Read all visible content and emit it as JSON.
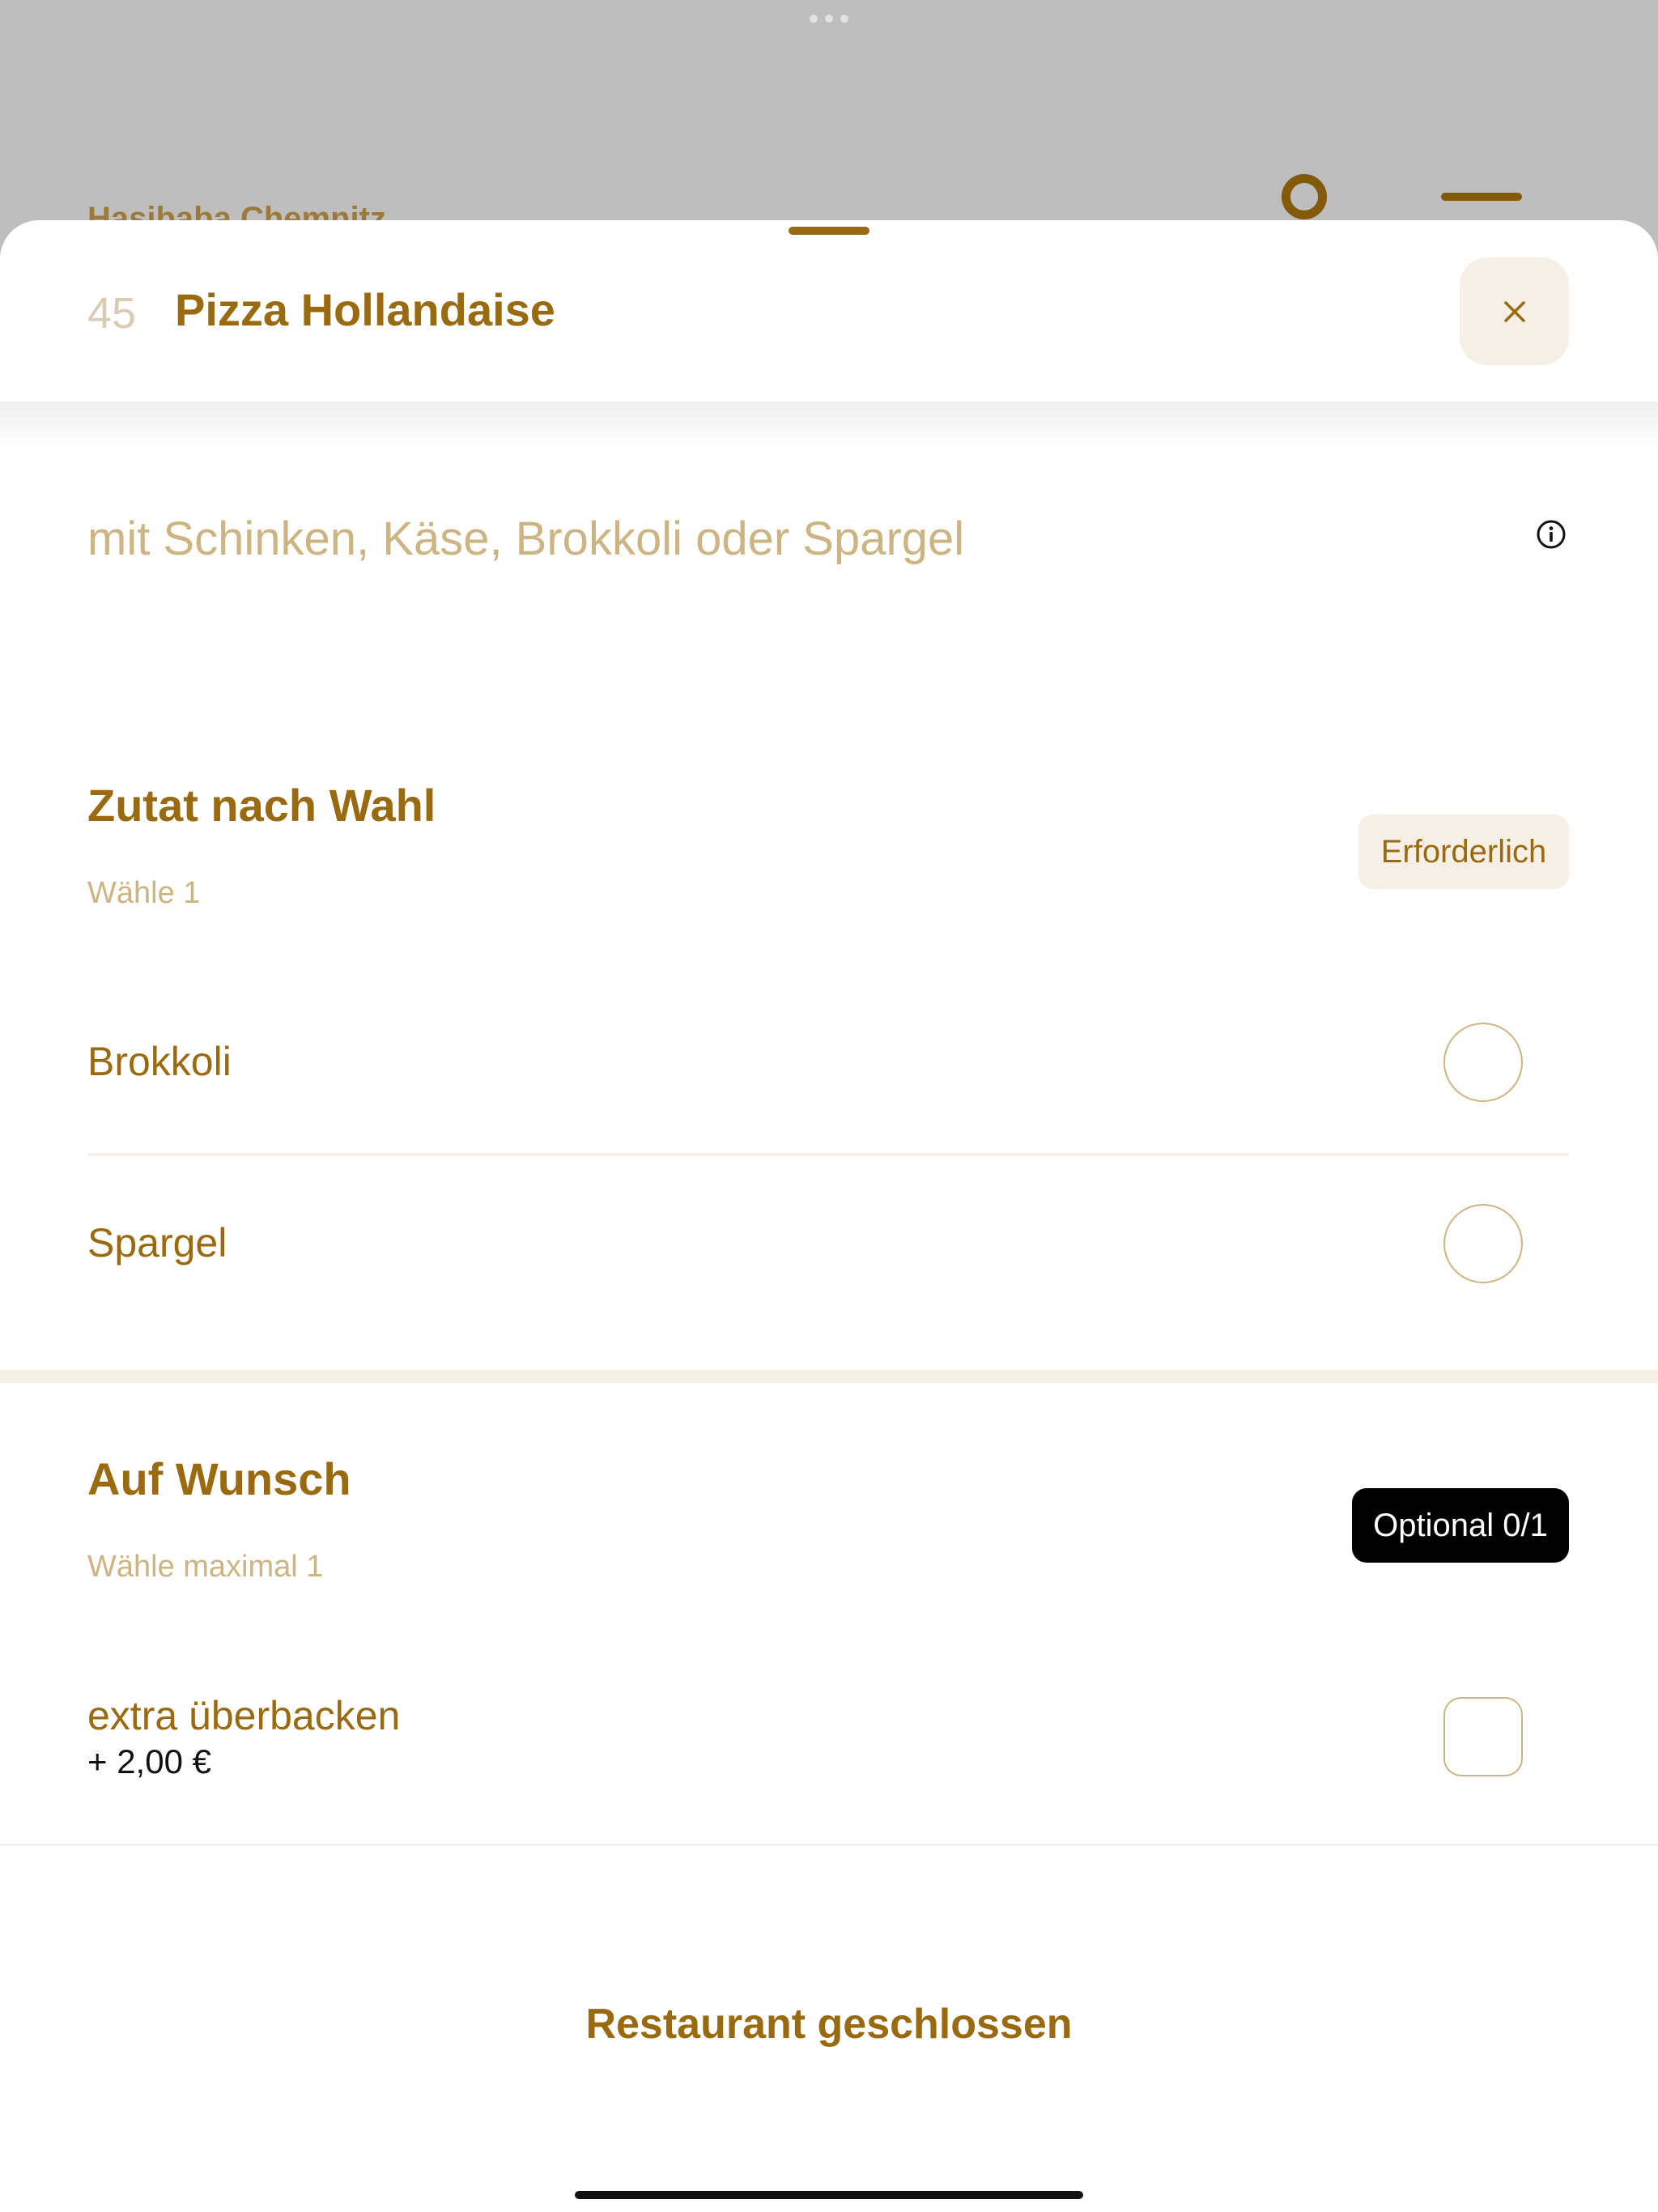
{
  "background": {
    "restaurant_name": "Hasibaba Chemnitz",
    "account_icon": "account-icon",
    "menu_icon": "menu-icon"
  },
  "item": {
    "number": "45",
    "title": "Pizza Hollandaise",
    "description": "mit Schinken, Käse, Brokkoli oder Spargel",
    "close_icon": "close-icon",
    "info_icon": "info-icon"
  },
  "groups": [
    {
      "title": "Zutat nach Wahl",
      "subtitle": "Wähle 1",
      "badge": "Erforderlich",
      "options": [
        {
          "label": "Brokkoli"
        },
        {
          "label": "Spargel"
        }
      ]
    },
    {
      "title": "Auf Wunsch",
      "subtitle": "Wähle maximal 1",
      "badge": "Optional 0/1",
      "options": [
        {
          "label": "extra überbacken",
          "price": "+ 2,00 €"
        }
      ]
    }
  ],
  "footer": {
    "status": "Restaurant geschlossen"
  },
  "colors": {
    "accent": "#9a6a10",
    "muted": "#cdb483",
    "chip_bg": "#f5efe5",
    "overlay": "#bebebe"
  }
}
